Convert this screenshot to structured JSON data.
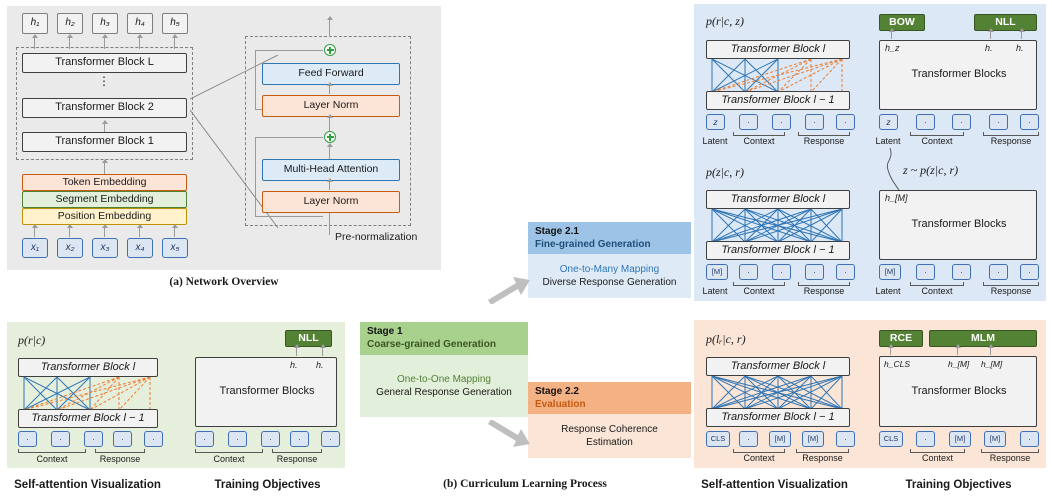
{
  "figure": {
    "captions": {
      "a": "(a) Network Overview",
      "b": "(b) Curriculum Learning Process"
    },
    "section_titles": {
      "self_attention": "Self-attention Visualization",
      "training_objectives": "Training Objectives"
    }
  },
  "network_overview": {
    "outputs": [
      "h₁",
      "h₂",
      "h₃",
      "h₄",
      "h₅"
    ],
    "inputs": [
      "x₁",
      "x₂",
      "x₃",
      "x₄",
      "x₅"
    ],
    "blocks": [
      "Transformer Block L",
      "Transformer Block 2",
      "Transformer Block 1"
    ],
    "ellipsis": "⋮",
    "embeddings": [
      "Token Embedding",
      "Segment Embedding",
      "Position Embedding"
    ],
    "detail": {
      "feed_forward": "Feed Forward",
      "layer_norm_top": "Layer Norm",
      "multi_head_attention": "Multi-Head Attention",
      "layer_norm_bottom": "Layer Norm",
      "residual_add_icon": "⊕",
      "note": "Pre-normalization"
    }
  },
  "curriculum": {
    "stage1": {
      "title": "Stage 1",
      "subtitle": "Coarse-grained Generation",
      "line1": "One-to-One Mapping",
      "line2": "General Response Generation"
    },
    "stage21": {
      "title": "Stage 2.1",
      "subtitle": "Fine-grained Generation",
      "line1": "One-to-Many Mapping",
      "line2": "Diverse Response Generation"
    },
    "stage22": {
      "title": "Stage 2.2",
      "subtitle": "Evaluation",
      "line1": "Response Coherence",
      "line2": "Estimation"
    }
  },
  "panels": {
    "stage1_panel": {
      "accent": "#e6efdc",
      "self_attention": {
        "prob": "p(r|c)",
        "block_top": "Transformer Block l",
        "block_bottom": "Transformer Block l − 1",
        "tokens": [
          "·",
          "·",
          "·",
          "·",
          "·"
        ],
        "group_labels": [
          "Context",
          "Response"
        ]
      },
      "objectives": {
        "heads": [
          "NLL"
        ],
        "block": "Transformer Blocks",
        "hidden_labels": [
          "h.",
          "h."
        ],
        "tokens": [
          "·",
          "·",
          "·",
          "·",
          "·"
        ],
        "group_labels": [
          "Context",
          "Response"
        ]
      }
    },
    "stage21_panel": {
      "accent": "#dce8f5",
      "self_attention_top": {
        "prob": "p(r|c, z)",
        "block_top": "Transformer Block l",
        "block_bottom": "Transformer Block l − 1",
        "tokens": [
          "z",
          "·",
          "·",
          "·",
          "·"
        ],
        "group_labels": [
          "Latent",
          "Context",
          "Response"
        ]
      },
      "self_attention_bottom": {
        "prob": "p(z|c, r)",
        "block_top": "Transformer Block l",
        "block_bottom": "Transformer Block l − 1",
        "tokens": [
          "[M]",
          "·",
          "·",
          "·",
          "·"
        ],
        "group_labels": [
          "Latent",
          "Context",
          "Response"
        ]
      },
      "objectives_top": {
        "heads": [
          "BOW",
          "NLL"
        ],
        "block": "Transformer Blocks",
        "hidden_labels": [
          "h_z",
          "h.",
          "h."
        ],
        "tokens": [
          "z",
          "·",
          "·",
          "·",
          "·"
        ],
        "group_labels": [
          "Latent",
          "Context",
          "Response"
        ]
      },
      "objectives_bottom": {
        "sampling_note": "z ~ p(z|c, r)",
        "block": "Transformer Blocks",
        "hidden_labels": [
          "h_[M]"
        ],
        "tokens": [
          "[M]",
          "·",
          "·",
          "·",
          "·"
        ],
        "group_labels": [
          "Latent",
          "Context",
          "Response"
        ]
      }
    },
    "stage22_panel": {
      "accent": "#fbe5d6",
      "self_attention": {
        "prob": "p(lᵣ|c, r)",
        "block_top": "Transformer Block l",
        "block_bottom": "Transformer Block l − 1",
        "tokens": [
          "CLS",
          "·",
          "[M]",
          "[M]",
          "·"
        ],
        "group_labels": [
          "Context",
          "Response"
        ]
      },
      "objectives": {
        "heads": [
          "RCE",
          "MLM"
        ],
        "block": "Transformer Blocks",
        "hidden_labels": [
          "h_CLS",
          "h_[M]",
          "h_[M]"
        ],
        "tokens": [
          "CLS",
          "·",
          "[M]",
          "[M]",
          "·"
        ],
        "group_labels": [
          "Context",
          "Response"
        ]
      }
    }
  },
  "colors": {
    "objective_head": "#548235",
    "token_box": "#dce6f3",
    "blue_attention": "#2e75b6",
    "orange_attention": "#ed7d31",
    "stage1": "#a9d18e",
    "stage21": "#9dc3e6",
    "stage22": "#f4b183"
  }
}
